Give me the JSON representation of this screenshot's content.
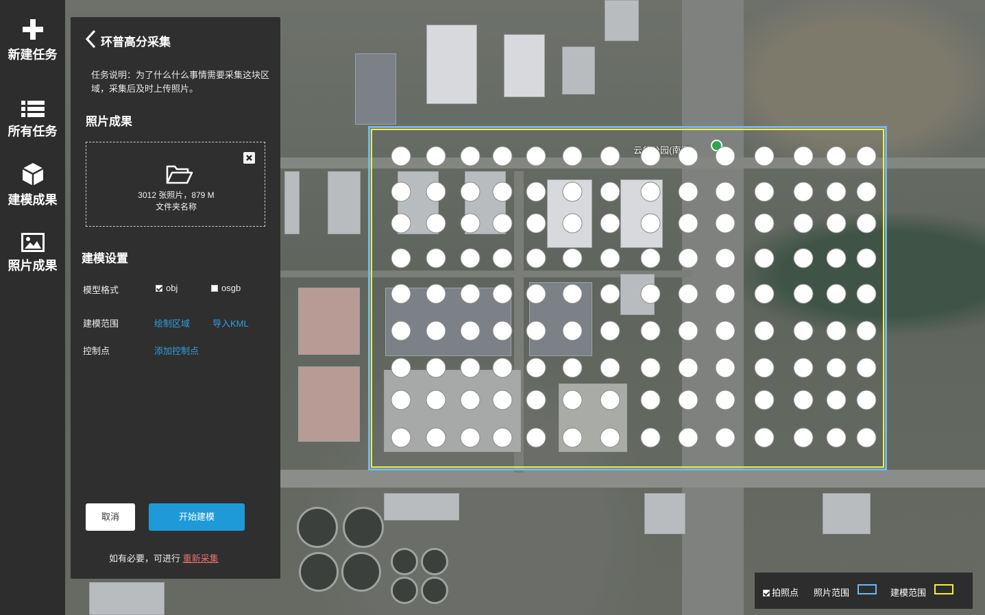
{
  "nav": {
    "items": [
      {
        "label": "新建任务",
        "icon": "plus-icon"
      },
      {
        "label": "所有任务",
        "icon": "list-icon"
      },
      {
        "label": "建模成果",
        "icon": "cube-icon"
      },
      {
        "label": "照片成果",
        "icon": "image-icon"
      }
    ]
  },
  "panel": {
    "title": "环普高分采集",
    "description": "任务说明：为了什么什么事情需要采集这块区域，采集后及时上传照片。",
    "photo_section_title": "照片成果",
    "photo_box": {
      "count_text": "3012 张照片，879 M",
      "folder_name": "文件夹名称"
    },
    "model_section_title": "建模设置",
    "format_label": "模型格式",
    "format_options": [
      {
        "label": "obj",
        "checked": true
      },
      {
        "label": "osgb",
        "checked": false
      }
    ],
    "range_label": "建模范围",
    "draw_area_link": "绘制区域",
    "import_kml_link": "导入KML",
    "control_label": "控制点",
    "add_control_link": "添加控制点",
    "cancel_button": "取消",
    "start_button": "开始建模",
    "footnote_prefix": "如有必要，可进行",
    "footnote_link": "重新采集"
  },
  "map": {
    "poi_label": "云谷公园(南门)",
    "grid": {
      "rows": 9,
      "cols": 14
    }
  },
  "legend": {
    "capture_points_label": "拍照点",
    "capture_points_checked": true,
    "photo_range_label": "照片范围",
    "photo_range_color": "#72b7ee",
    "model_range_label": "建模范围",
    "model_range_color": "#f2f23c"
  }
}
